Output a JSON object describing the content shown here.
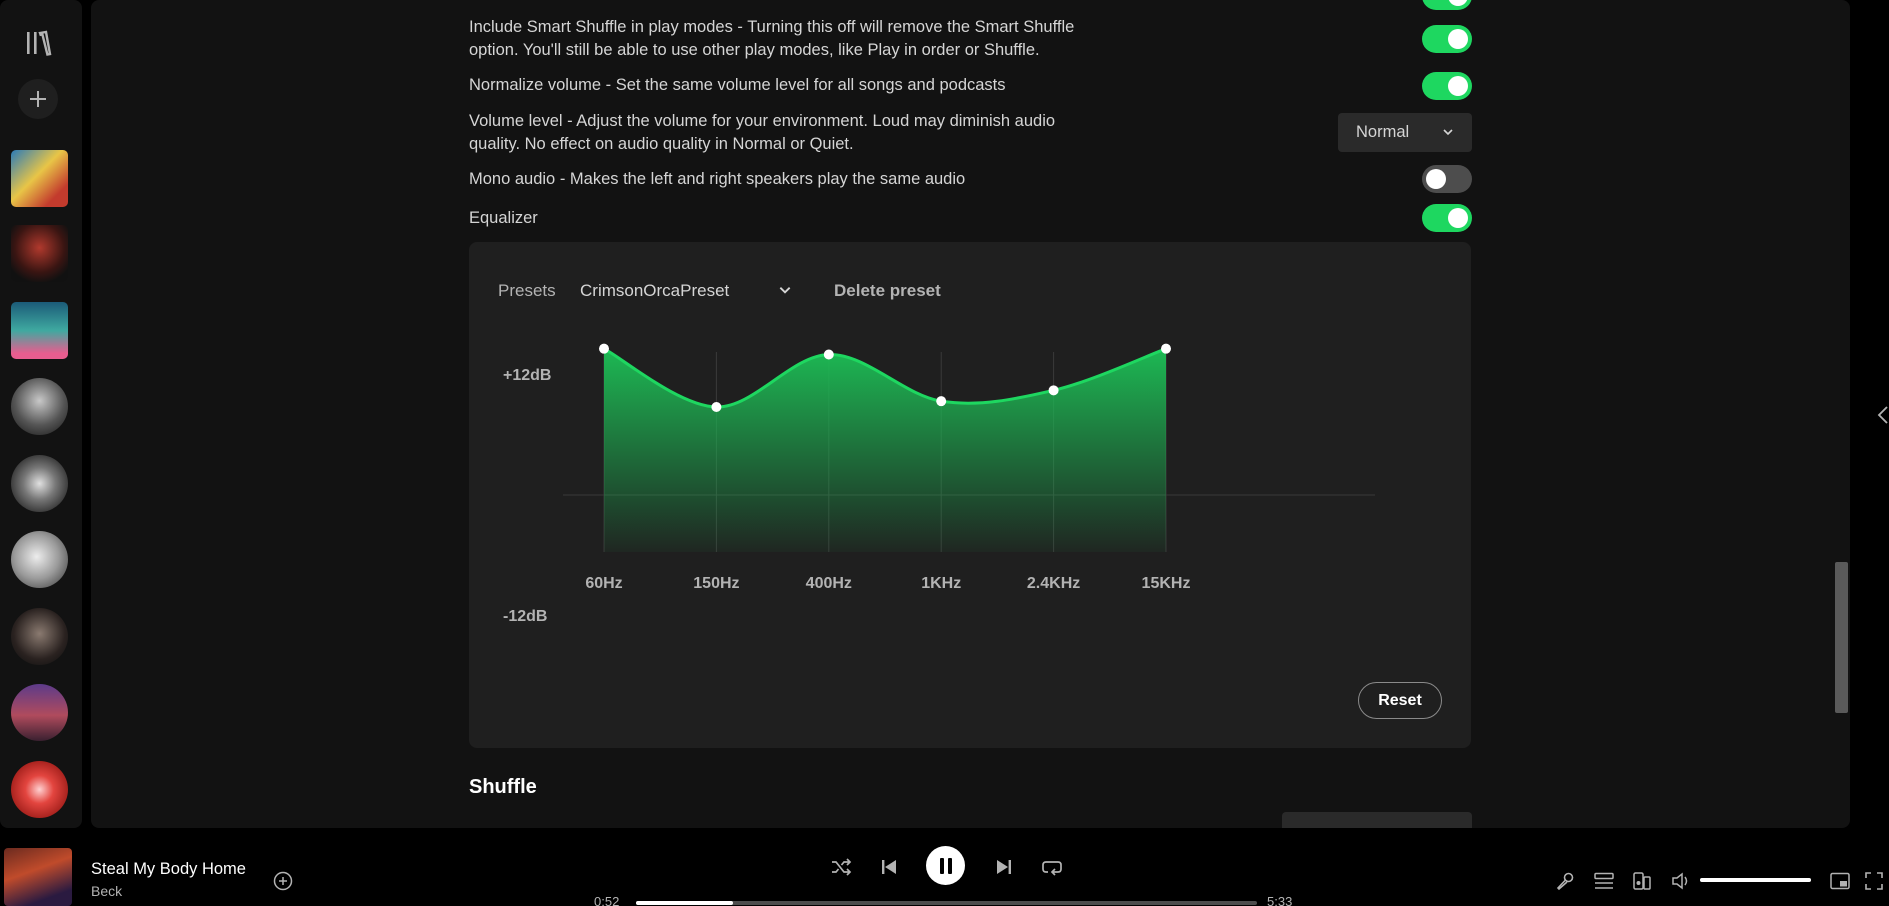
{
  "settings": {
    "smart_shuffle": {
      "line1": "Include Smart Shuffle in play modes - Turning this off will remove the Smart Shuffle",
      "line2": "option. You'll still be able to use other play modes, like Play in order or Shuffle.",
      "enabled": true
    },
    "normalize_volume": {
      "label": "Normalize volume - Set the same volume level for all songs and podcasts",
      "enabled": true
    },
    "volume_level": {
      "line1": "Volume level - Adjust the volume for your environment. Loud may diminish audio",
      "line2": "quality. No effect on audio quality in Normal or Quiet.",
      "value": "Normal"
    },
    "mono_audio": {
      "label": "Mono audio - Makes the left and right speakers play the same audio",
      "enabled": false
    },
    "equalizer": {
      "label": "Equalizer",
      "enabled": true
    }
  },
  "equalizer": {
    "presets_label": "Presets",
    "preset_value": "CrimsonOrcaPreset",
    "delete_label": "Delete preset",
    "reset_label": "Reset",
    "max_label": "+12dB",
    "min_label": "-12dB",
    "accent": "#1ed760"
  },
  "chart_data": {
    "type": "area",
    "categories": [
      "60Hz",
      "150Hz",
      "400Hz",
      "1KHz",
      "2.4KHz",
      "15KHz"
    ],
    "values": [
      10,
      3,
      9.3,
      3.7,
      5,
      10
    ],
    "ylim": [
      -12,
      12
    ]
  },
  "shuffle": {
    "title": "Shuffle"
  },
  "player": {
    "track_title": "Steal My Body Home",
    "artist": "Beck",
    "elapsed": "0:52",
    "duration": "5:33",
    "progress": 0.157,
    "volume": 1.0
  },
  "icons": {
    "library": "library-icon",
    "add": "plus-icon",
    "shuffle": "shuffle-icon",
    "previous": "skip-back-icon",
    "pause": "pause-icon",
    "next": "skip-forward-icon",
    "repeat": "repeat-icon",
    "lyrics": "microphone-icon",
    "queue": "queue-icon",
    "connect": "connect-device-icon",
    "volume": "speaker-icon",
    "miniplayer": "miniplayer-icon",
    "fullscreen": "fullscreen-icon"
  }
}
